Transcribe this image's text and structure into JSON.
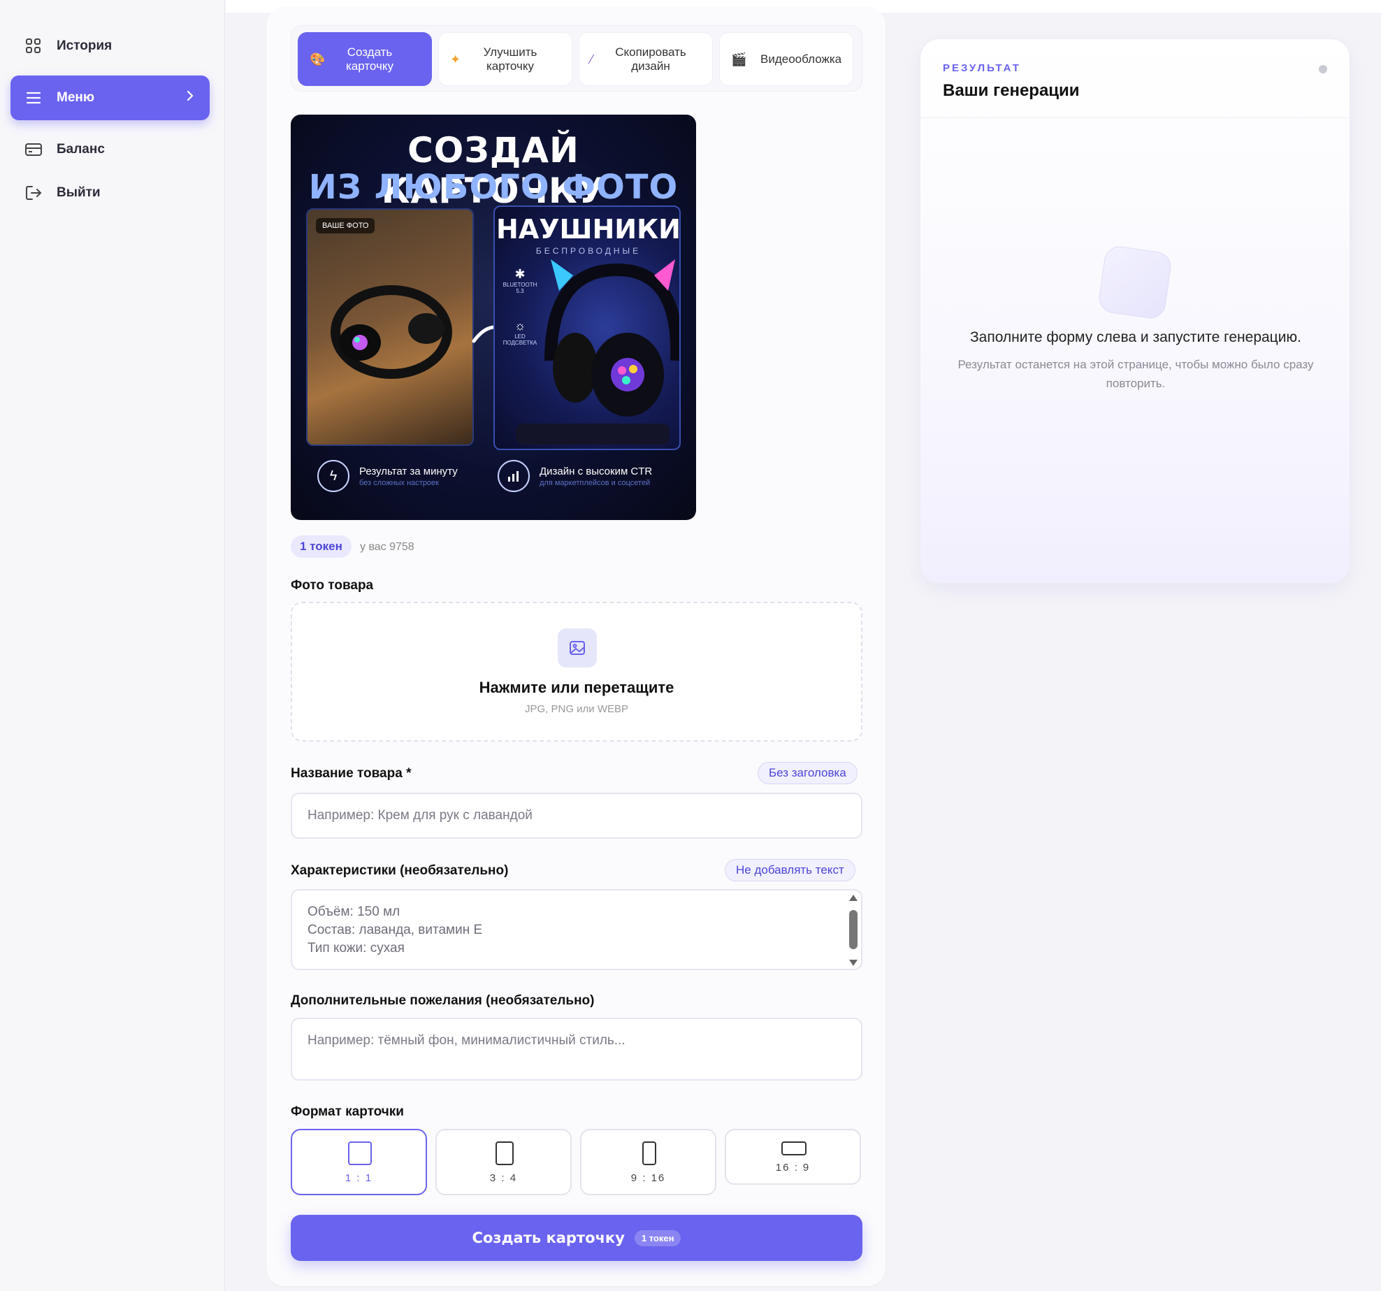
{
  "sidebar": {
    "items": [
      {
        "label": "История",
        "icon": "grid-icon"
      },
      {
        "label": "Меню",
        "icon": "menu-icon"
      },
      {
        "label": "Баланс",
        "icon": "card-icon"
      },
      {
        "label": "Выйти",
        "icon": "logout-icon"
      }
    ]
  },
  "tabs": [
    {
      "label": "Создать карточку",
      "icon": "palette-icon"
    },
    {
      "label": "Улучшить карточку",
      "icon": "sparkle-icon"
    },
    {
      "label": "Скопировать дизайн",
      "icon": "magic-wand-icon"
    },
    {
      "label": "Видеообложка",
      "icon": "clapper-icon"
    }
  ],
  "preview": {
    "title_line1": "СОЗДАЙ КАРТОЧКУ",
    "title_line2": "ИЗ ЛЮБОГО ФОТО",
    "badge": "ВАШЕ ФОТО",
    "product_title": "НАУШНИКИ",
    "product_subtitle": "БЕСПРОВОДНЫЕ",
    "spec1": "BLUETOOTH 5.3",
    "spec2": "LED ПОДСВЕТКА",
    "feature1_title": "Результат за минуту",
    "feature1_sub": "без сложных настроек",
    "feature2_title": "Дизайн с высоким CTR",
    "feature2_sub": "для маркетплейсов и соцсетей"
  },
  "token": {
    "cost": "1 токен",
    "balance": "у вас 9758"
  },
  "photo": {
    "label": "Фото товара",
    "title": "Нажмите или перетащите",
    "formats": "JPG, PNG или WEBP"
  },
  "name_field": {
    "label": "Название товара *",
    "chip": "Без заголовка",
    "placeholder": "Например: Крем для рук с лавандой"
  },
  "specs_field": {
    "label": "Характеристики (необязательно)",
    "chip": "Не добавлять текст",
    "lines": [
      "Объём: 150 мл",
      "Состав: лаванда, витамин E",
      "Тип кожи: сухая"
    ]
  },
  "wishes_field": {
    "label": "Дополнительные пожелания (необязательно)",
    "placeholder": "Например: тёмный фон, минималистичный стиль..."
  },
  "format": {
    "label": "Формат карточки",
    "options": [
      "1 : 1",
      "3 : 4",
      "9 : 16",
      "16 : 9"
    ],
    "selected": "1 : 1"
  },
  "submit": {
    "label": "Создать карточку",
    "badge": "1 токен"
  },
  "result": {
    "kicker": "РЕЗУЛЬТАТ",
    "title": "Ваши генерации",
    "message": "Заполните форму слева и запустите генерацию.",
    "sub": "Результат останется на этой странице, чтобы можно было сразу повторить."
  },
  "colors": {
    "accent": "#6a63ef",
    "chip_bg": "#f1f0fe",
    "bg": "#f4f4f8"
  }
}
